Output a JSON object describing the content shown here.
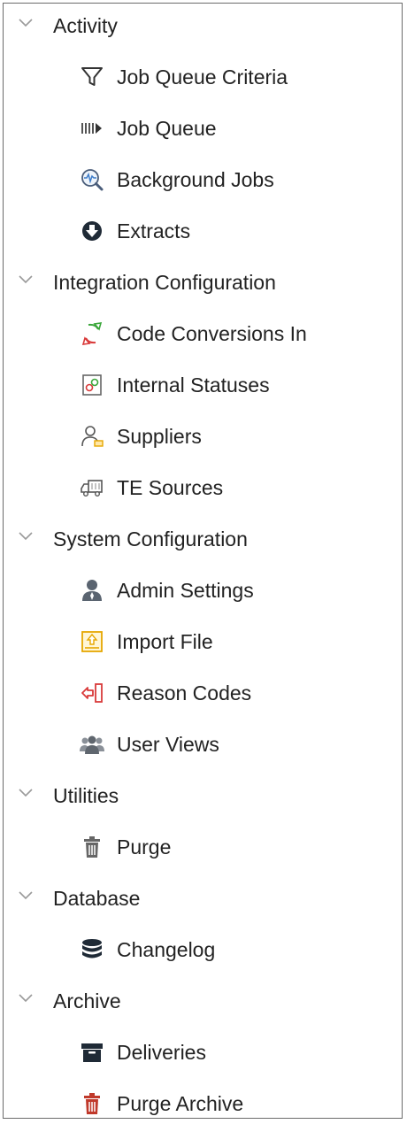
{
  "sections": [
    {
      "label": "Activity",
      "items": [
        {
          "label": "Job Queue Criteria",
          "icon": "filter-icon"
        },
        {
          "label": "Job Queue",
          "icon": "queue-icon"
        },
        {
          "label": "Background Jobs",
          "icon": "background-jobs-icon"
        },
        {
          "label": "Extracts",
          "icon": "download-circle-icon"
        }
      ]
    },
    {
      "label": "Integration Configuration",
      "items": [
        {
          "label": "Code Conversions In",
          "icon": "conversion-arrows-icon"
        },
        {
          "label": "Internal Statuses",
          "icon": "status-doc-icon"
        },
        {
          "label": "Suppliers",
          "icon": "supplier-user-icon"
        },
        {
          "label": "TE Sources",
          "icon": "truck-icon"
        }
      ]
    },
    {
      "label": "System Configuration",
      "items": [
        {
          "label": "Admin Settings",
          "icon": "admin-user-icon"
        },
        {
          "label": "Import File",
          "icon": "import-file-icon"
        },
        {
          "label": "Reason Codes",
          "icon": "reason-codes-icon"
        },
        {
          "label": "User Views",
          "icon": "users-group-icon"
        }
      ]
    },
    {
      "label": "Utilities",
      "items": [
        {
          "label": "Purge",
          "icon": "trash-icon"
        }
      ]
    },
    {
      "label": "Database",
      "items": [
        {
          "label": "Changelog",
          "icon": "database-icon"
        }
      ]
    },
    {
      "label": "Archive",
      "items": [
        {
          "label": "Deliveries",
          "icon": "archive-box-icon"
        },
        {
          "label": "Purge Archive",
          "icon": "trash-red-icon"
        }
      ]
    }
  ]
}
